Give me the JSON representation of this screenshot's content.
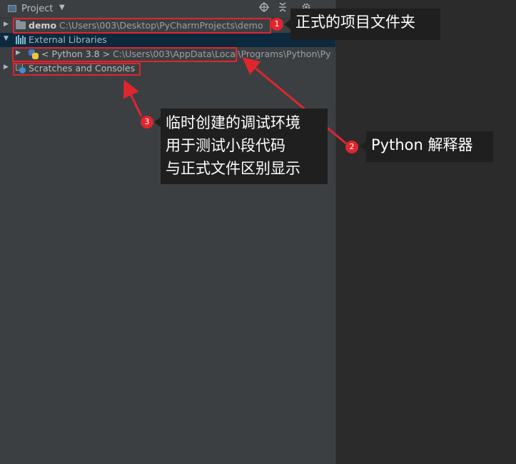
{
  "header": {
    "title": "Project"
  },
  "tree": {
    "demo": {
      "name": "demo",
      "path": "C:\\Users\\003\\Desktop\\PyCharmProjects\\demo"
    },
    "external_libraries": {
      "label": "External Libraries"
    },
    "python_sdk": {
      "name": "< Python 3.8 >",
      "path": "C:\\Users\\003\\AppData\\Local\\Programs\\Python\\Py"
    },
    "scratches": {
      "label": "Scratches and Consoles"
    }
  },
  "annotations": {
    "one": {
      "number": "1",
      "text": "正式的项目文件夹"
    },
    "two": {
      "number": "2",
      "text": "Python 解释器"
    },
    "three": {
      "number": "3",
      "lines": [
        "临时创建的调试环境",
        "用于测试小段代码",
        "与正式文件区别显示"
      ]
    }
  },
  "colors": {
    "accent": "#e0252e",
    "selection": "#0d293e",
    "panel": "#3c3f41",
    "editor": "#2b2b2b"
  }
}
